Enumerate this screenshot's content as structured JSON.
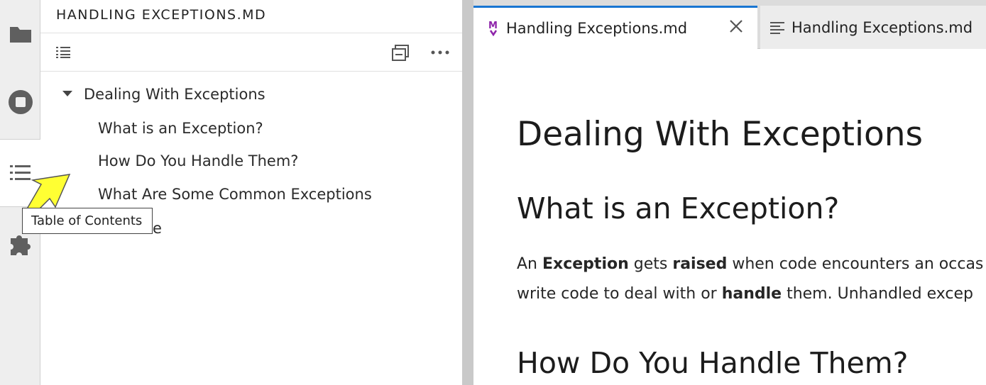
{
  "sidebar": {
    "title": "HANDLING EXCEPTIONS.MD",
    "toc": [
      {
        "label": "Dealing With Exceptions",
        "level": 1,
        "expanded": true
      },
      {
        "label": "What is an Exception?",
        "level": 2
      },
      {
        "label": "How Do You Handle Them?",
        "level": 2
      },
      {
        "label": "What Are Some Common Exceptions",
        "level": 2
      },
      {
        "label": "e",
        "level": 2
      }
    ]
  },
  "activity_bar": {
    "items": [
      "folder-icon",
      "stop-circle-icon",
      "table-of-contents-icon",
      "extension-puzzle-icon"
    ],
    "active": "table-of-contents-icon"
  },
  "tooltip": {
    "text": "Table of Contents"
  },
  "tabs": [
    {
      "label": "Handling Exceptions.md",
      "icon": "markdown-m-icon",
      "active": true
    },
    {
      "label": "Handling Exceptions.md",
      "icon": "text-lines-icon",
      "active": false
    }
  ],
  "document": {
    "h1": "Dealing With Exceptions",
    "h2_1": "What is an Exception?",
    "p1": {
      "t1": "An ",
      "b1": "Exception",
      "t2": " gets ",
      "b2": "raised",
      "t3": " when code encounters an occas"
    },
    "p2": {
      "t1": "write code to deal with or ",
      "b1": "handle",
      "t2": " them. Unhandled excep"
    },
    "h2_2": "How Do You Handle Them?"
  },
  "colors": {
    "accent": "#1976d2",
    "markdown_icon": "#8e24aa",
    "highlight_arrow": "#ffff33"
  }
}
